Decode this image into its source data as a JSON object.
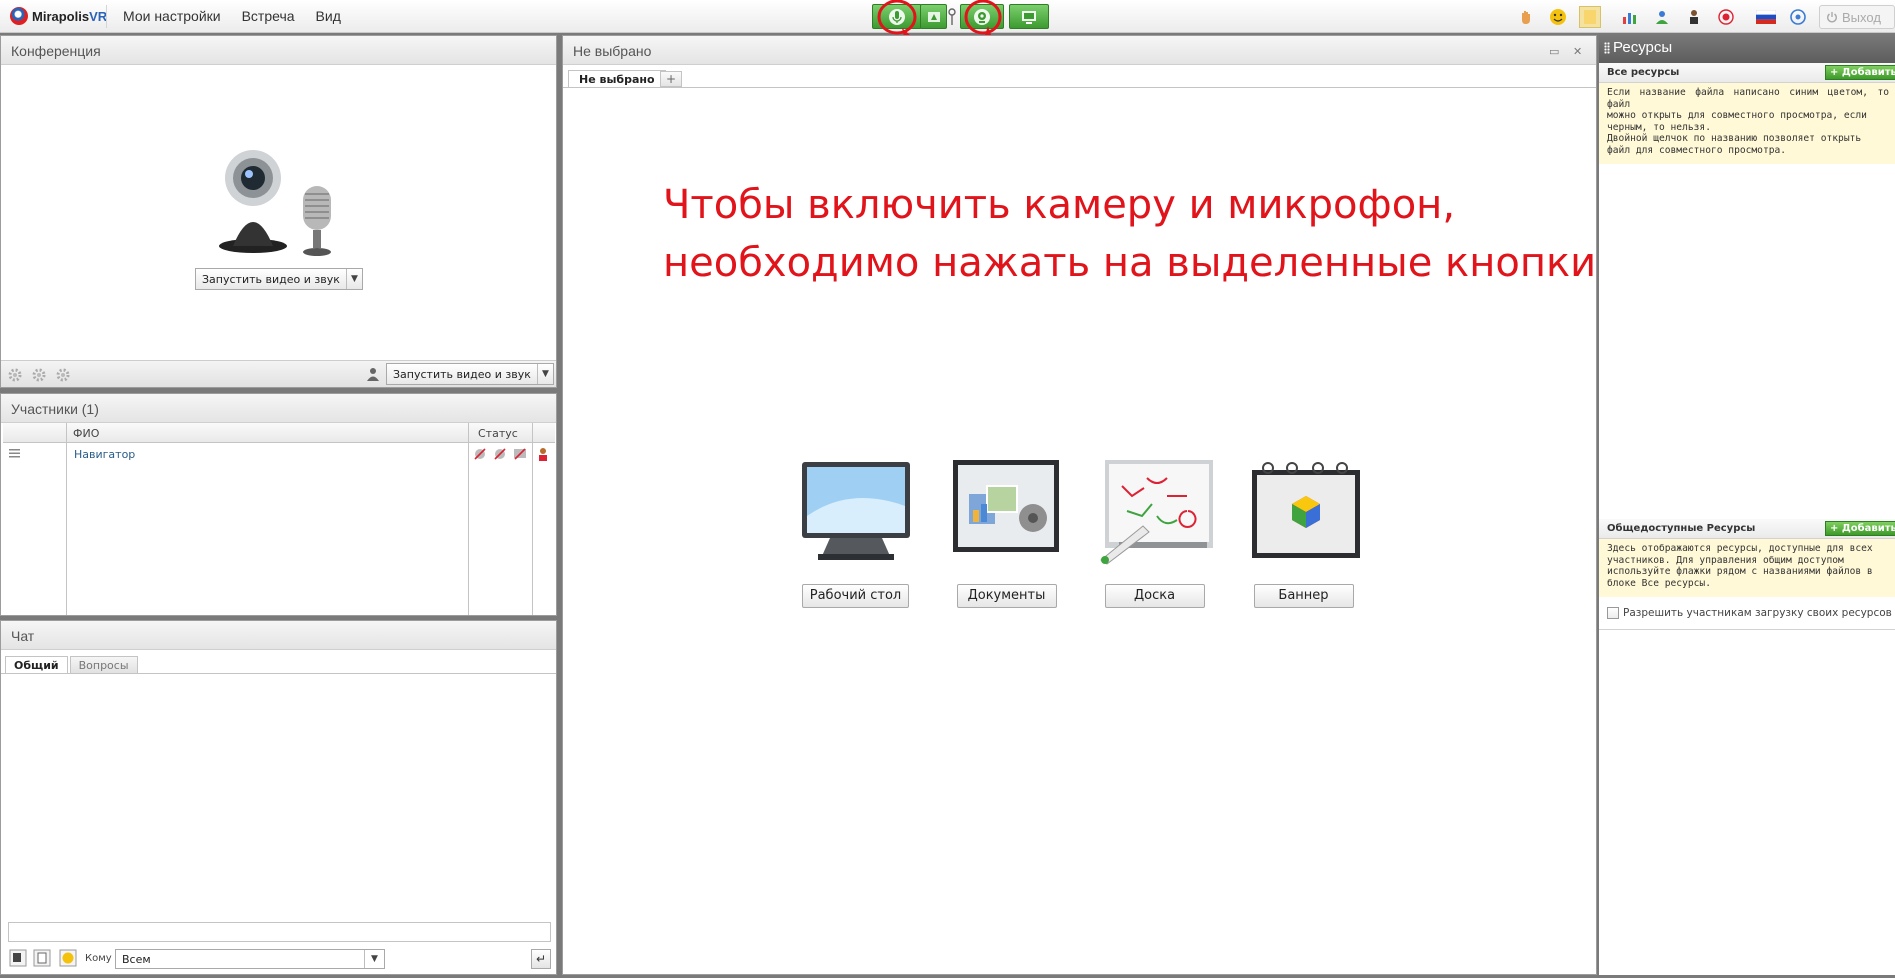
{
  "app": {
    "logo_name": "Mirapolis",
    "logo_suffix": "VR"
  },
  "menu": [
    "Мои настройки",
    "Встреча",
    "Вид"
  ],
  "exit_label": "Выход",
  "conference": {
    "title": "Конференция",
    "start_button": "Запустить видео и звук",
    "bottom_start_button": "Запустить видео и звук"
  },
  "participants": {
    "title": "Участники (1)",
    "columns": [
      "ФИО",
      "Статус"
    ],
    "rows": [
      {
        "name": "Навигатор"
      }
    ]
  },
  "chat": {
    "title": "Чат",
    "tabs": [
      "Общий",
      "Вопросы"
    ],
    "to_label": "Кому",
    "to_value": "Всем",
    "input_value": ""
  },
  "center": {
    "title": "Не выбрано",
    "tab_label": "Не выбрано",
    "add_tab": "+",
    "instruction_line1": "Чтобы включить камеру и микрофон,",
    "instruction_line2": "необходимо нажать на выделенные кнопки",
    "tools": [
      "Рабочий стол",
      "Документы",
      "Доска",
      "Баннер"
    ]
  },
  "resources": {
    "title": "Ресурсы",
    "all_title": "Все ресурсы",
    "add_label": "+ Добавить",
    "all_note": "Если название файла написано синим цветом, то файл\nможно открыть для совместного просмотра, если\nчерным, то нельзя.\nДвойной щелчок по названию позволяет открыть\nфайл для совместного просмотра.",
    "public_title": "Общедоступные Ресурсы",
    "public_add_label": "+ Добавить",
    "public_note": "Здесь отображаются ресурсы, доступные для всех\nучастников. Для управления общим доступом\nиспользуйте флажки рядом с названиями файлов в\nблоке Все ресурсы.",
    "allow_upload": "Разрешить участникам загрузку своих ресурсов"
  },
  "colors": {
    "accent_green": "#3c9b30",
    "annotation_red": "#e0141a",
    "link_blue": "#2a5c8a"
  }
}
